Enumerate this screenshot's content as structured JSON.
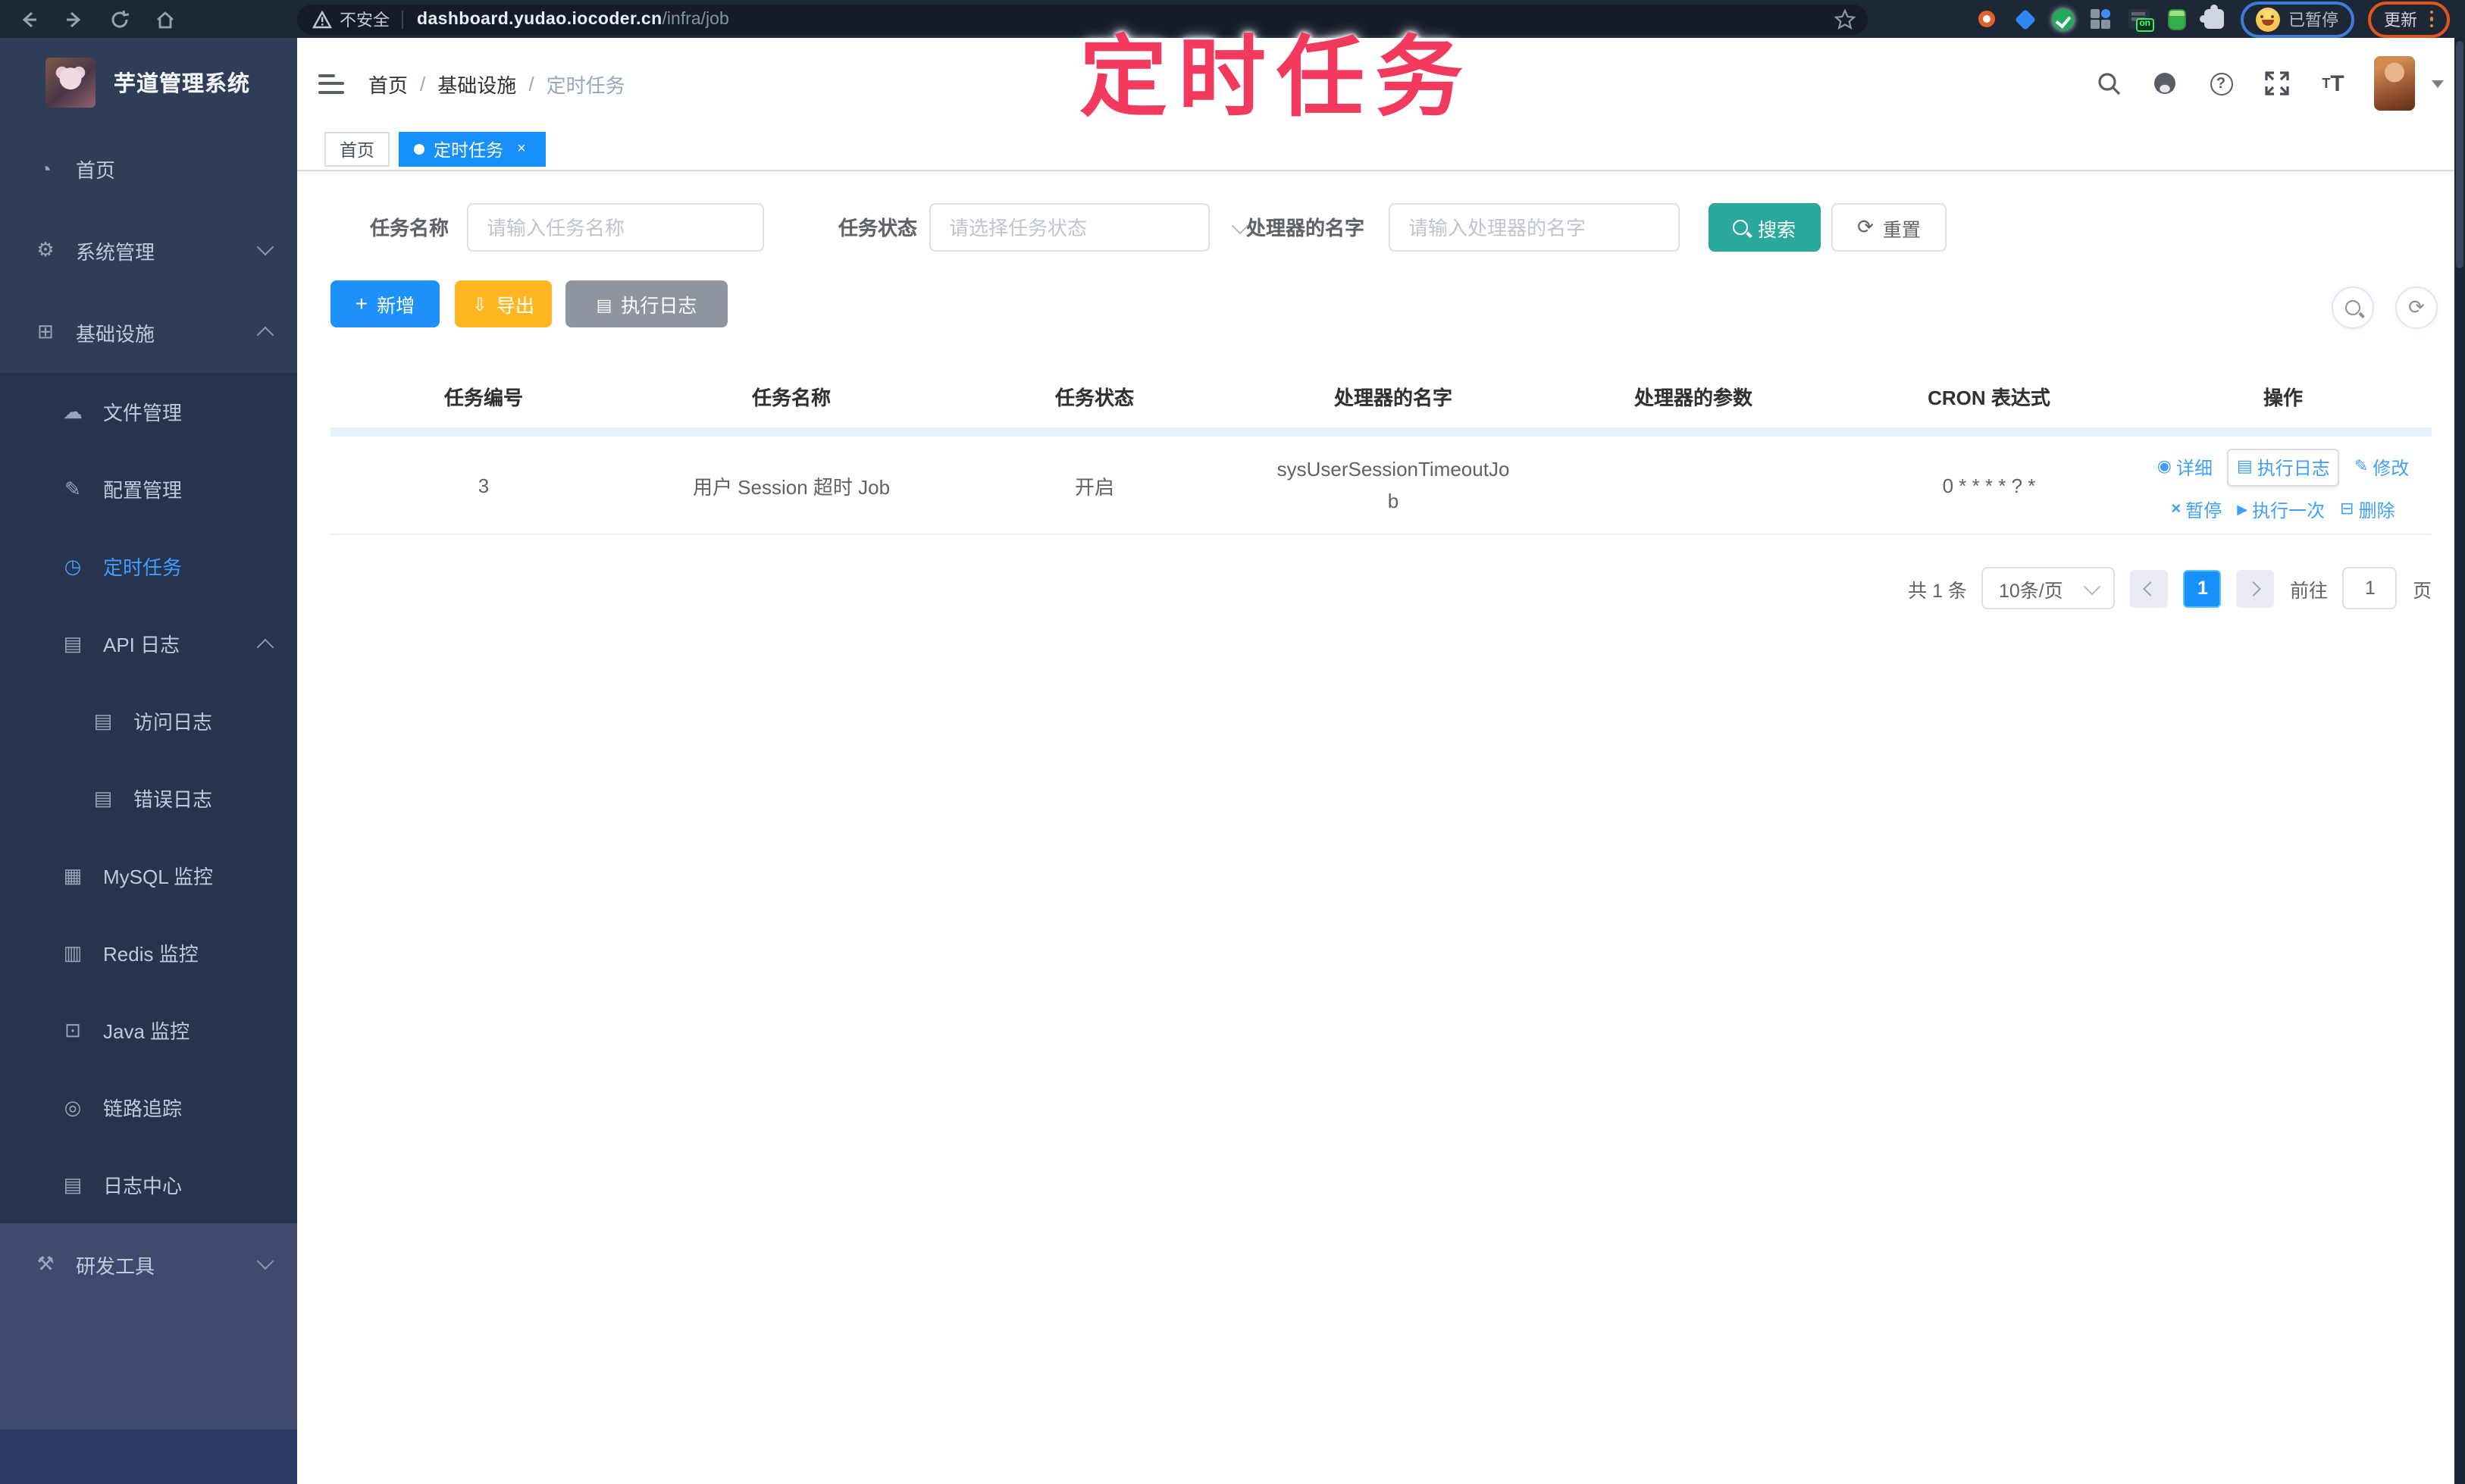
{
  "browser": {
    "security_label": "不安全",
    "url_host": "dashboard.yudao.iocoder.cn",
    "url_path": "/infra/job",
    "extension_on_badge": "on",
    "paused_label": "已暂停",
    "update_label": "更新"
  },
  "annotation": {
    "title": "定时任务"
  },
  "sidebar": {
    "app_title": "芋道管理系统",
    "items": [
      {
        "label": "首页"
      },
      {
        "label": "系统管理"
      },
      {
        "label": "基础设施"
      },
      {
        "label": "文件管理"
      },
      {
        "label": "配置管理"
      },
      {
        "label": "定时任务"
      },
      {
        "label": "API 日志"
      },
      {
        "label": "访问日志"
      },
      {
        "label": "错误日志"
      },
      {
        "label": "MySQL 监控"
      },
      {
        "label": "Redis 监控"
      },
      {
        "label": "Java 监控"
      },
      {
        "label": "链路追踪"
      },
      {
        "label": "日志中心"
      },
      {
        "label": "研发工具"
      }
    ]
  },
  "header": {
    "breadcrumb": [
      "首页",
      "基础设施",
      "定时任务"
    ]
  },
  "tabs": [
    {
      "label": "首页"
    },
    {
      "label": "定时任务"
    }
  ],
  "filter": {
    "name_label": "任务名称",
    "name_placeholder": "请输入任务名称",
    "status_label": "任务状态",
    "status_placeholder": "请选择任务状态",
    "handler_label": "处理器的名字",
    "handler_placeholder": "请输入处理器的名字",
    "search_label": "搜索",
    "reset_label": "重置"
  },
  "toolbar": {
    "add_label": "新增",
    "export_label": "导出",
    "job_log_label": "执行日志"
  },
  "table": {
    "headers": [
      "任务编号",
      "任务名称",
      "任务状态",
      "处理器的名字",
      "处理器的参数",
      "CRON 表达式",
      "操作"
    ],
    "rows": [
      {
        "id": "3",
        "name": "用户 Session 超时 Job",
        "status": "开启",
        "handler": "sysUserSessionTimeoutJob",
        "param": "",
        "cron": "0 * * * * ? *"
      }
    ],
    "actions": [
      "详细",
      "执行日志",
      "修改",
      "暂停",
      "执行一次",
      "删除"
    ]
  },
  "pagination": {
    "total": "共 1 条",
    "page_size": "10条/页",
    "page": "1",
    "goto_label": "前往",
    "goto_value": "1",
    "page_unit": "页"
  },
  "colors": {
    "accent": "#1890fa",
    "link": "#409eff",
    "search_teal": "#2ba89c",
    "export_amber": "#ffb620",
    "log_grey": "#8f959e",
    "annotation_pink": "#f23a5f"
  }
}
